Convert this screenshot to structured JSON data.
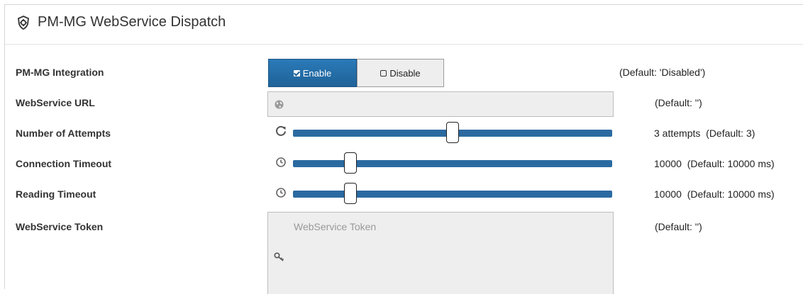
{
  "panel": {
    "title": "PM-MG WebService Dispatch",
    "title_icon": "shield-gear-icon"
  },
  "rows": {
    "integration": {
      "label": "PM-MG Integration",
      "enable_label": "Enable",
      "disable_label": "Disable",
      "selected": "Enable",
      "default_text": "(Default: 'Disabled')"
    },
    "url": {
      "label": "WebService URL",
      "value": "",
      "icon": "globe-icon",
      "default_text": "(Default: '')"
    },
    "attempts": {
      "label": "Number of Attempts",
      "icon": "refresh-icon",
      "value_text": "3 attempts",
      "default_text": "(Default: 3)",
      "level": 0.5
    },
    "connection_timeout": {
      "label": "Connection Timeout",
      "icon": "clock-icon",
      "value_text": "10000",
      "default_text": "(Default: 10000 ms)",
      "level": 0.18
    },
    "reading_timeout": {
      "label": "Reading Timeout",
      "icon": "clock-icon",
      "value_text": "10000",
      "default_text": "(Default: 10000 ms)",
      "level": 0.18
    },
    "token": {
      "label": "WebService Token",
      "placeholder": "WebService Token",
      "value": "",
      "icon": "key-icon",
      "default_text": "(Default: '')"
    }
  },
  "colors": {
    "accent": "#2b6aa1",
    "enable_button": "#1f6298",
    "field_background": "#eeeeee"
  }
}
